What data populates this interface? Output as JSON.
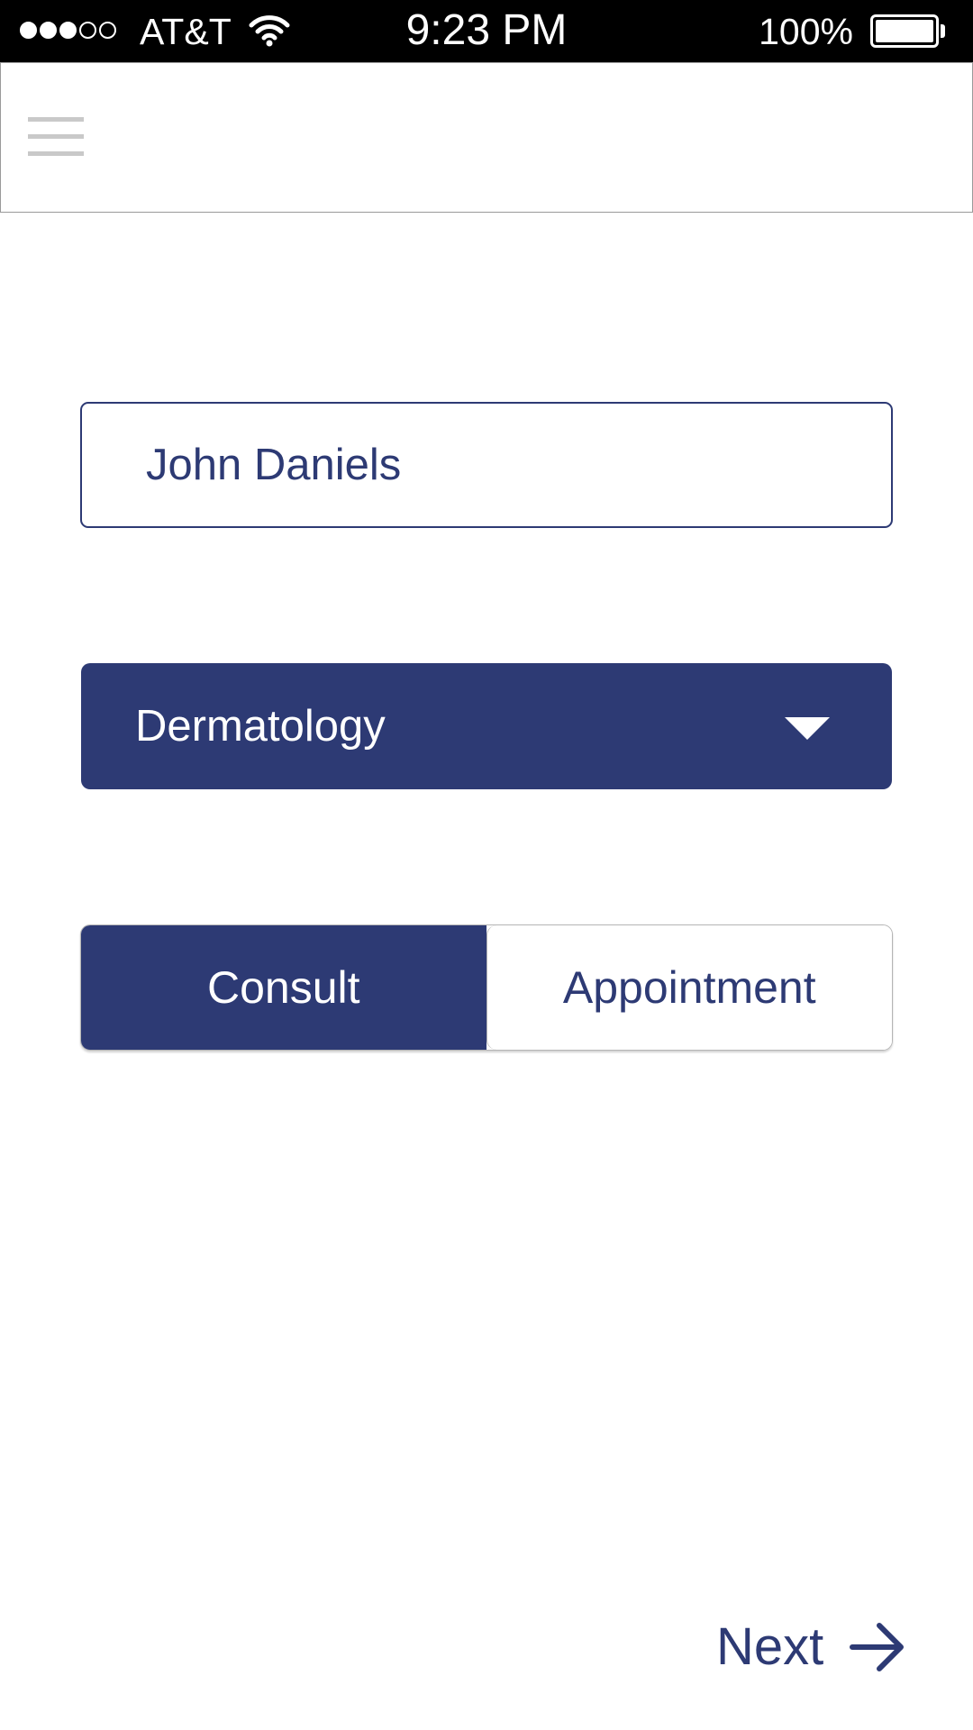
{
  "status_bar": {
    "signal_bars": 3,
    "signal_total": 5,
    "carrier": "AT&T",
    "time": "9:23 PM",
    "battery_percent": "100%",
    "battery_level": 1.0,
    "wifi_icon": "wifi-icon",
    "battery_icon": "battery-icon"
  },
  "header": {
    "menu_icon": "hamburger-menu-icon"
  },
  "form": {
    "name_value": "John Daniels",
    "specialty_selected": "Dermatology",
    "specialty_icon": "chevron-down-icon",
    "visit_type": {
      "options": [
        "Consult",
        "Appointment"
      ],
      "selected": "Consult"
    }
  },
  "footer": {
    "next_label": "Next",
    "next_icon": "arrow-right-icon"
  },
  "colors": {
    "primary": "#2d3a74",
    "status_bar_bg": "#000000",
    "menu_icon": "#c9c9c9",
    "background": "#ffffff"
  }
}
